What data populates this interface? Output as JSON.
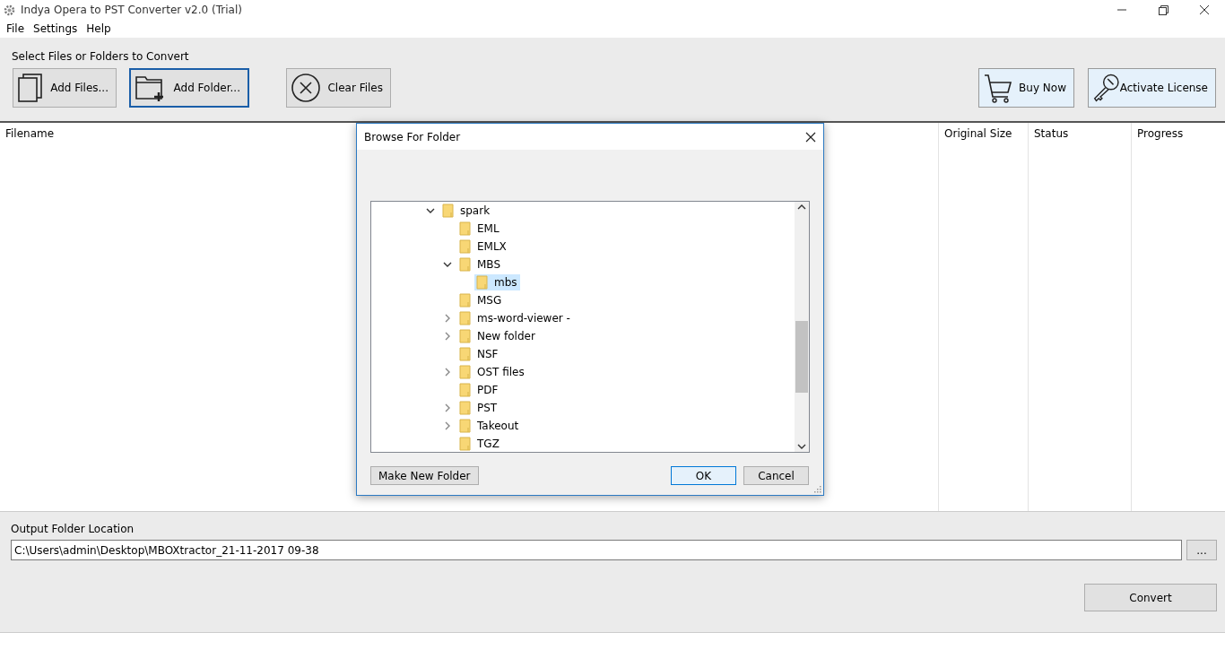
{
  "window": {
    "title": "Indya Opera to PST Converter v2.0 (Trial)"
  },
  "menu": [
    "File",
    "Settings",
    "Help"
  ],
  "toolbar": {
    "label": "Select Files or Folders to Convert",
    "buttons": [
      {
        "label": "Add Files...",
        "kind": "files",
        "focused": false
      },
      {
        "label": "Add Folder...",
        "kind": "folder",
        "focused": true
      },
      {
        "label": "Clear Files",
        "kind": "clear",
        "focused": false
      },
      {
        "label": "Buy Now",
        "kind": "cart",
        "focused": false
      },
      {
        "label": "Activate License",
        "kind": "key",
        "focused": false
      }
    ]
  },
  "table": {
    "columns": [
      "Filename",
      "Original Size",
      "Status",
      "Progress"
    ]
  },
  "dialog": {
    "title": "Browse For Folder",
    "tree": [
      {
        "label": "spark",
        "expandable": true,
        "expanded": true,
        "selected": false,
        "children": [
          {
            "label": "EML",
            "expandable": false,
            "expanded": false,
            "selected": false
          },
          {
            "label": "EMLX",
            "expandable": false,
            "expanded": false,
            "selected": false
          },
          {
            "label": "MBS",
            "expandable": true,
            "expanded": true,
            "selected": false,
            "children": [
              {
                "label": "mbs",
                "expandable": false,
                "expanded": false,
                "selected": true
              }
            ]
          },
          {
            "label": "MSG",
            "expandable": false,
            "expanded": false,
            "selected": false
          },
          {
            "label": "ms-word-viewer -",
            "expandable": true,
            "expanded": false,
            "selected": false
          },
          {
            "label": "New folder",
            "expandable": true,
            "expanded": false,
            "selected": false
          },
          {
            "label": "NSF",
            "expandable": false,
            "expanded": false,
            "selected": false
          },
          {
            "label": "OST files",
            "expandable": true,
            "expanded": false,
            "selected": false
          },
          {
            "label": "PDF",
            "expandable": false,
            "expanded": false,
            "selected": false
          },
          {
            "label": "PST",
            "expandable": true,
            "expanded": false,
            "selected": false
          },
          {
            "label": "Takeout",
            "expandable": true,
            "expanded": false,
            "selected": false
          },
          {
            "label": "TGZ",
            "expandable": false,
            "expanded": false,
            "selected": false
          }
        ]
      }
    ],
    "buttons": [
      {
        "label": "Make New Folder",
        "default": false
      },
      {
        "label": "OK",
        "default": true
      },
      {
        "label": "Cancel",
        "default": false
      }
    ]
  },
  "output": {
    "label": "Output Folder Location",
    "value": "C:\\Users\\admin\\Desktop\\MBOXtractor_21-11-2017 09-38",
    "browse_button": "...",
    "convert_button": "Convert"
  }
}
